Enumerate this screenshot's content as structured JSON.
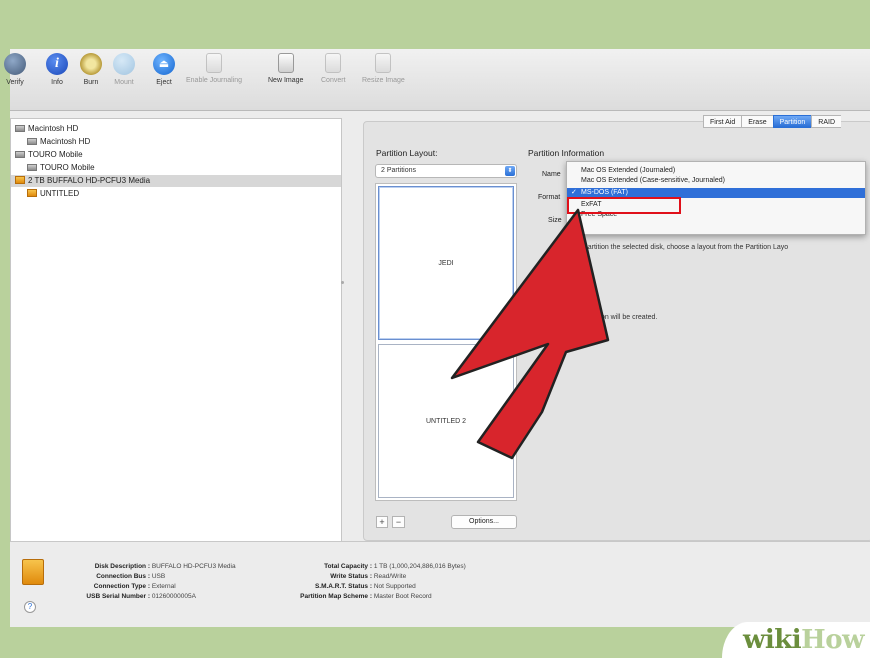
{
  "toolbar": {
    "items": [
      {
        "label": "Verify",
        "icon": "microscope-icon"
      },
      {
        "label": "Info",
        "icon": "info-icon"
      },
      {
        "label": "Burn",
        "icon": "burn-icon"
      },
      {
        "label": "Mount",
        "icon": "mount-icon"
      },
      {
        "label": "Eject",
        "icon": "eject-icon"
      },
      {
        "label": "Enable Journaling",
        "icon": "journaling-icon"
      },
      {
        "label": "New Image",
        "icon": "new-image-icon"
      },
      {
        "label": "Convert",
        "icon": "convert-icon"
      },
      {
        "label": "Resize Image",
        "icon": "resize-image-icon"
      }
    ]
  },
  "sidebar": {
    "items": [
      {
        "label": "Macintosh HD"
      },
      {
        "label": "Macintosh HD"
      },
      {
        "label": "TOURO Mobile"
      },
      {
        "label": "TOURO Mobile"
      },
      {
        "label": "2 TB BUFFALO HD-PCFU3 Media"
      },
      {
        "label": "UNTITLED"
      }
    ]
  },
  "tabs": [
    "First Aid",
    "Erase",
    "Partition",
    "RAID"
  ],
  "partition": {
    "layout_label": "Partition Layout:",
    "layout_value": "2 Partitions",
    "info_label": "Partition Information",
    "name_label": "Name",
    "format_label": "Format",
    "size_label": "Size",
    "parts": [
      "JEDI",
      "UNTITLED 2"
    ],
    "plus": "+",
    "minus": "−",
    "options": "Options...",
    "desc1": "d partition the selected disk, choose a layout from the Partition Layo",
    "desc2": "d partition will be created."
  },
  "dropdown": {
    "items": [
      "Mac OS Extended (Journaled)",
      "Mac OS Extended (Case-sensitive, Journaled)",
      "MS-DOS (FAT)",
      "ExFAT",
      "Free Space"
    ],
    "selected_index": 2,
    "check": "✓"
  },
  "info": {
    "disk_description_k": "Disk Description :",
    "disk_description_v": "BUFFALO HD-PCFU3 Media",
    "connection_bus_k": "Connection Bus :",
    "connection_bus_v": "USB",
    "connection_type_k": "Connection Type :",
    "connection_type_v": "External",
    "usb_serial_k": "USB Serial Number :",
    "usb_serial_v": "01260000005A",
    "total_capacity_k": "Total Capacity :",
    "total_capacity_v": "1 TB (1,000,204,886,016 Bytes)",
    "write_status_k": "Write Status :",
    "write_status_v": "Read/Write",
    "smart_k": "S.M.A.R.T. Status :",
    "smart_v": "Not Supported",
    "scheme_k": "Partition Map Scheme :",
    "scheme_v": "Master Boot Record",
    "help": "?"
  },
  "watermark": {
    "part1": "wiki",
    "part2": "How"
  },
  "colors": {
    "annotation_arrow": "#d8252c",
    "highlight_box": "#e0101a",
    "selection": "#2f6fd8"
  }
}
